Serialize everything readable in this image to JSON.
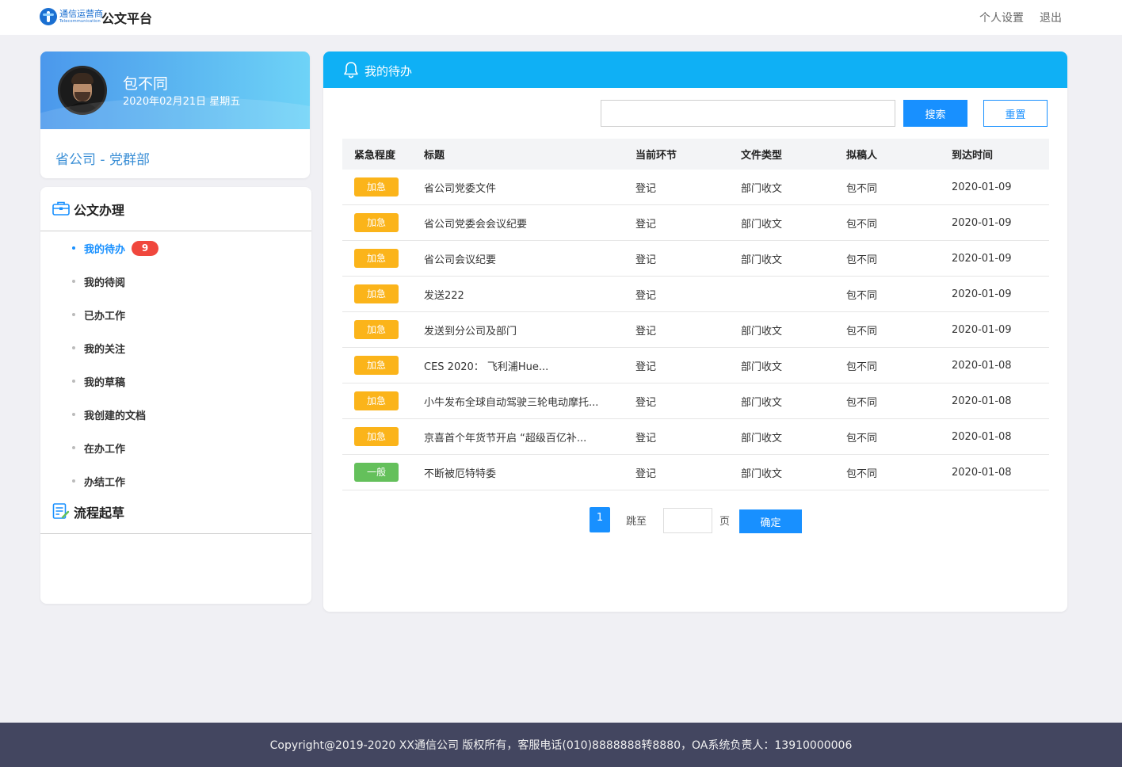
{
  "header": {
    "logo_cn": "通信运营商",
    "logo_en": "Telecommunication",
    "app_title": "公文平台",
    "settings_label": "个人设置",
    "logout_label": "退出"
  },
  "user": {
    "name": "包不同",
    "date": "2020年02月21日 星期五",
    "department": "省公司 - 党群部"
  },
  "sidebar": {
    "section1_title": "公文办理",
    "items": [
      {
        "label": "我的待办",
        "badge": "9",
        "active": true
      },
      {
        "label": "我的待阅"
      },
      {
        "label": "已办工作"
      },
      {
        "label": "我的关注"
      },
      {
        "label": "我的草稿"
      },
      {
        "label": "我创建的文档"
      },
      {
        "label": "在办工作"
      },
      {
        "label": "办结工作"
      }
    ],
    "section2_title": "流程起草"
  },
  "main": {
    "panel_title": "我的待办",
    "search_value": "",
    "search_button": "搜索",
    "reset_button": "重置",
    "columns": [
      "紧急程度",
      "标题",
      "当前环节",
      "文件类型",
      "拟稿人",
      "到达时间"
    ],
    "rows": [
      {
        "priority": "加急",
        "level": "urgent",
        "title": "省公司党委文件",
        "step": "登记",
        "type": "部门收文",
        "author": "包不同",
        "time": "2020-01-09"
      },
      {
        "priority": "加急",
        "level": "urgent",
        "title": "省公司党委会会议纪要",
        "step": "登记",
        "type": "部门收文",
        "author": "包不同",
        "time": "2020-01-09"
      },
      {
        "priority": "加急",
        "level": "urgent",
        "title": "省公司会议纪要",
        "step": "登记",
        "type": "部门收文",
        "author": "包不同",
        "time": "2020-01-09"
      },
      {
        "priority": "加急",
        "level": "urgent",
        "title": "发送222",
        "step": "登记",
        "type": "",
        "author": "包不同",
        "time": "2020-01-09"
      },
      {
        "priority": "加急",
        "level": "urgent",
        "title": "发送到分公司及部门",
        "step": "登记",
        "type": "部门收文",
        "author": "包不同",
        "time": "2020-01-09"
      },
      {
        "priority": "加急",
        "level": "urgent",
        "title": "CES 2020： 飞利浦Hue...",
        "step": "登记",
        "type": "部门收文",
        "author": "包不同",
        "time": "2020-01-08"
      },
      {
        "priority": "加急",
        "level": "urgent",
        "title": "小牛发布全球自动驾驶三轮电动摩托...",
        "step": "登记",
        "type": "部门收文",
        "author": "包不同",
        "time": "2020-01-08"
      },
      {
        "priority": "加急",
        "level": "urgent",
        "title": "京喜首个年货节开启 “超级百亿补...",
        "step": "登记",
        "type": "部门收文",
        "author": "包不同",
        "time": "2020-01-08"
      },
      {
        "priority": "一般",
        "level": "normal",
        "title": "不断被厄特特委",
        "step": "登记",
        "type": "部门收文",
        "author": "包不同",
        "time": "2020-01-08"
      }
    ],
    "pager": {
      "current_page": "1",
      "goto_label": "跳至",
      "page_value": "",
      "page_label": "页",
      "confirm_label": "确定"
    }
  },
  "footer": {
    "text": "Copyright@2019-2020 XX通信公司 版权所有，客服电话(010)8888888转8880，OA系统负责人：13910000006"
  },
  "colors": {
    "accent": "#1890ff",
    "panel_header": "#0fb0f5",
    "urgent": "#fbb41a",
    "normal": "#64c05b",
    "badge": "#f0473d",
    "footer_bg": "#434660"
  }
}
